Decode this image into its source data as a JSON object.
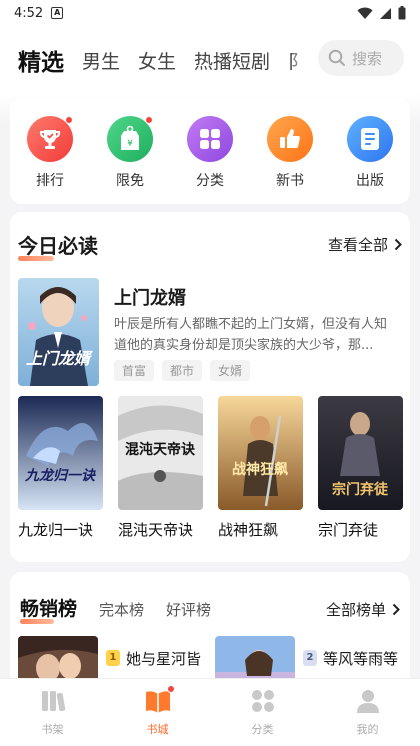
{
  "status": {
    "time": "4:52",
    "badge": "A"
  },
  "topnav": {
    "tabs": [
      "精选",
      "男生",
      "女生",
      "热播短剧",
      "阝"
    ],
    "search_placeholder": "搜索"
  },
  "quick": [
    {
      "label": "排行",
      "icon": "trophy-icon",
      "color": "#f5564a",
      "dot": true
    },
    {
      "label": "限免",
      "icon": "price-tag-icon",
      "color": "#2fbf71",
      "dot": true
    },
    {
      "label": "分类",
      "icon": "grid-icon",
      "color": "#9b59e6",
      "dot": false
    },
    {
      "label": "新书",
      "icon": "thumbs-up-icon",
      "color": "#ff8a2a",
      "dot": false
    },
    {
      "label": "出版",
      "icon": "book-icon",
      "color": "#3e8ef7",
      "dot": false
    }
  ],
  "today": {
    "title": "今日必读",
    "more": "查看全部",
    "featured": {
      "title": "上门龙婿",
      "desc": "叶辰是所有人都瞧不起的上门女婿，但没有人知道他的真实身份却是顶尖家族的大少爷，那...",
      "tags": [
        "首富",
        "都市",
        "女婿"
      ],
      "cover_text": "上门龙婿"
    },
    "books": [
      {
        "name": "九龙归一诀",
        "cover_text": "九龙归一诀"
      },
      {
        "name": "混沌天帝诀",
        "cover_text": "混沌天帝诀"
      },
      {
        "name": "战神狂飙",
        "cover_text": "战神狂飙"
      },
      {
        "name": "宗门弃徒",
        "cover_text": "宗门弃徒"
      }
    ]
  },
  "best": {
    "tabs": [
      "畅销榜",
      "完本榜",
      "好评榜"
    ],
    "more": "全部榜单",
    "items": [
      {
        "rank": "1",
        "name": "她与星河皆"
      },
      {
        "rank": "2",
        "name": "等风等雨等"
      }
    ]
  },
  "bottomnav": [
    {
      "label": "书架",
      "icon": "bookshelf-icon",
      "active": false
    },
    {
      "label": "书城",
      "icon": "bookstore-icon",
      "active": true
    },
    {
      "label": "分类",
      "icon": "category-icon",
      "active": false
    },
    {
      "label": "我的",
      "icon": "profile-icon",
      "active": false
    }
  ]
}
